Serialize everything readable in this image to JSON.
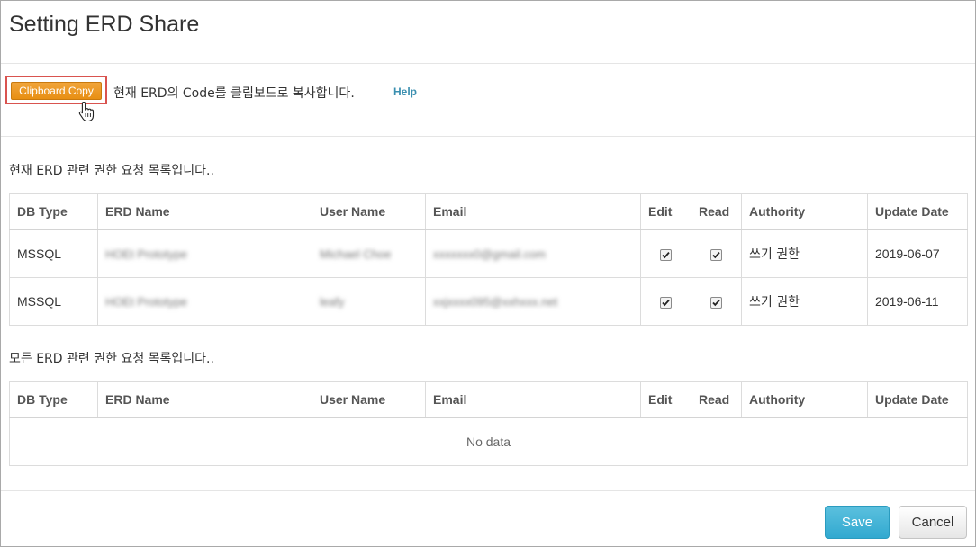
{
  "dialog": {
    "title": "Setting ERD Share"
  },
  "clipboard": {
    "button_label": "Clipboard Copy",
    "description": "현재 ERD의 Code를 클립보드로 복사합니다.",
    "help_label": "Help"
  },
  "current_requests": {
    "heading": "현재 ERD 관련 권한 요청 목록입니다..",
    "columns": [
      "DB Type",
      "ERD Name",
      "User Name",
      "Email",
      "Edit",
      "Read",
      "Authority",
      "Update Date"
    ],
    "rows": [
      {
        "db_type": "MSSQL",
        "erd_name": "HOEt Prototype",
        "user_name": "Michael Choe",
        "email": "xxxxxxx0@gmail.com",
        "edit": true,
        "read": true,
        "authority": "쓰기 권한",
        "update_date": "2019-06-07"
      },
      {
        "db_type": "MSSQL",
        "erd_name": "HOEt Prototype",
        "user_name": "leafy",
        "email": "xxjxxxx095@xxhxxx.net",
        "edit": true,
        "read": true,
        "authority": "쓰기 권한",
        "update_date": "2019-06-11"
      }
    ]
  },
  "all_requests": {
    "heading": "모든 ERD 관련 권한 요청 목록입니다..",
    "columns": [
      "DB Type",
      "ERD Name",
      "User Name",
      "Email",
      "Edit",
      "Read",
      "Authority",
      "Update Date"
    ],
    "empty_text": "No data"
  },
  "footer": {
    "save_label": "Save",
    "cancel_label": "Cancel"
  },
  "colors": {
    "clipboard_button": "#e8921a",
    "save_button": "#46b8da",
    "help_link": "#3a8fb0"
  }
}
